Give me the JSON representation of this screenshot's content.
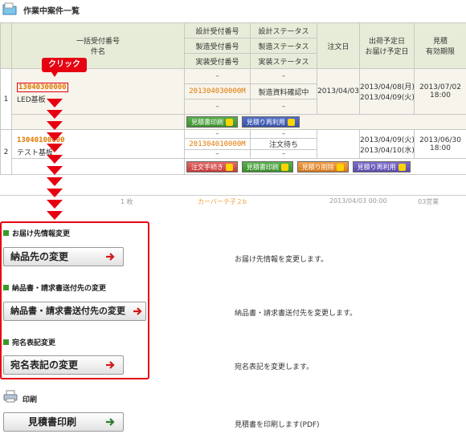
{
  "header": {
    "title": "作業中案件一覧",
    "icon": "folder-icon"
  },
  "table": {
    "col_head_1a": "一括受付番号",
    "col_head_1b": "件名",
    "col_head_2a": "設計受付番号",
    "col_head_2b": "製造受付番号",
    "col_head_2c": "実装受付番号",
    "col_head_3a": "設計ステータス",
    "col_head_3b": "製造ステータス",
    "col_head_3c": "実装ステータス",
    "col_head_4": "注文日",
    "col_head_5a": "出荷予定日",
    "col_head_5b": "お届け予定日",
    "col_head_6a": "見積",
    "col_head_6b": "有効期限",
    "rows": [
      {
        "no": "1",
        "bulk_no": "13040300000",
        "name": "LED基板",
        "design_no": "–",
        "mfg_no": "201304030000M",
        "mount_no": "–",
        "design_status": "–",
        "mfg_status": "製造資料確認中",
        "mount_status": "–",
        "order_date": "2013/04/03",
        "ship_date": "2013/04/08(月)",
        "deliver_date": "2013/04/09(火)",
        "expire_date": "2013/07/02",
        "expire_time": "18:00",
        "btn1": "見積書印刷",
        "btn2": "見積り再利用"
      },
      {
        "no": "2",
        "bulk_no": "13040100000",
        "name": "テスト基板",
        "design_no": "–",
        "mfg_no": "201304010000M",
        "mount_no": "–",
        "design_status": "–",
        "mfg_status": "注文待ち",
        "mount_status": "–",
        "order_date": "",
        "ship_date": "2013/04/09(火)",
        "deliver_date": "2013/04/10(水)",
        "expire_date": "2013/06/30",
        "expire_time": "18:00",
        "btn1": "注文手続き",
        "btn2": "見積書印刷",
        "btn3": "見積り削除",
        "btn4": "見積り再利用"
      }
    ],
    "partial_row": {
      "qty": "1 枚",
      "link": "カーバーテ子２b",
      "date": "2013/04/03 00:00",
      "note": "03営業"
    }
  },
  "callout": "クリック",
  "sections": {
    "delivery": {
      "heading": "お届け先情報変更",
      "button": "納品先の変更",
      "desc": "お届け先情報を変更します。"
    },
    "invoice": {
      "heading": "納品書・請求書送付先の変更",
      "button": "納品書・請求書送付先の変更",
      "desc": "納品書・請求書送付先を変更します。"
    },
    "address": {
      "heading": "宛名表記変更",
      "button": "宛名表記の変更",
      "desc": "宛名表記を変更します。"
    },
    "print": {
      "heading": "印刷",
      "button": "見積書印刷",
      "desc": "見積書を印刷します(PDF)"
    }
  },
  "colors": {
    "accent_red": "#e60012",
    "header_bg": "#e7ecd8",
    "number_orange": "#e07800",
    "section_green": "#3a9a2a"
  }
}
